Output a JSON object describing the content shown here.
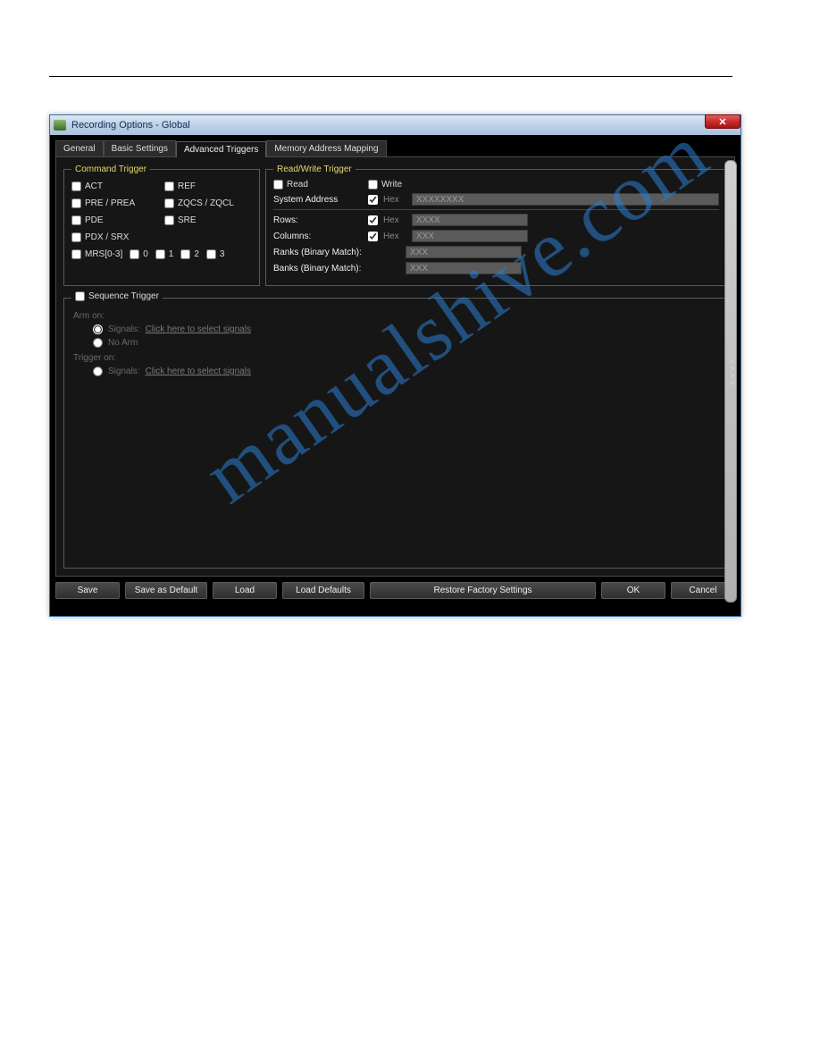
{
  "window": {
    "title": "Recording Options - Global"
  },
  "tabs": [
    "General",
    "Basic Settings",
    "Advanced Triggers",
    "Memory Address Mapping"
  ],
  "activeTabIndex": 2,
  "commandTrigger": {
    "legend": "Command Trigger",
    "items": [
      "ACT",
      "REF",
      "PRE / PREA",
      "ZQCS / ZQCL",
      "PDE",
      "SRE",
      "PDX / SRX"
    ],
    "mrs": {
      "label": "MRS[0-3]",
      "bits": [
        "0",
        "1",
        "2",
        "3"
      ]
    }
  },
  "rwTrigger": {
    "legend": "Read/Write Trigger",
    "read": "Read",
    "write": "Write",
    "rows": [
      {
        "label": "System Address",
        "hasHexCb": true,
        "hex": "Hex",
        "value": "XXXXXXXX",
        "long": true
      },
      {
        "label": "Rows:",
        "hasHexCb": true,
        "hex": "Hex",
        "value": "XXXX",
        "long": false
      },
      {
        "label": "Columns:",
        "hasHexCb": true,
        "hex": "Hex",
        "value": "XXX",
        "long": false
      },
      {
        "label": "Ranks (Binary Match):",
        "hasHexCb": false,
        "hex": "",
        "value": "XXX",
        "long": false
      },
      {
        "label": "Banks (Binary Match):",
        "hasHexCb": false,
        "hex": "",
        "value": "XXX",
        "long": false
      }
    ]
  },
  "seqTrigger": {
    "legend": "Sequence Trigger",
    "armOn": "Arm on:",
    "triggerOn": "Trigger on:",
    "signals": "Signals:",
    "noArm": "No Arm",
    "link": "Click here to select signals"
  },
  "buttons": {
    "save": "Save",
    "saveDefault": "Save as Default",
    "load": "Load",
    "loadDefaults": "Load Defaults",
    "restore": "Restore Factory Settings",
    "ok": "OK",
    "cancel": "Cancel"
  }
}
